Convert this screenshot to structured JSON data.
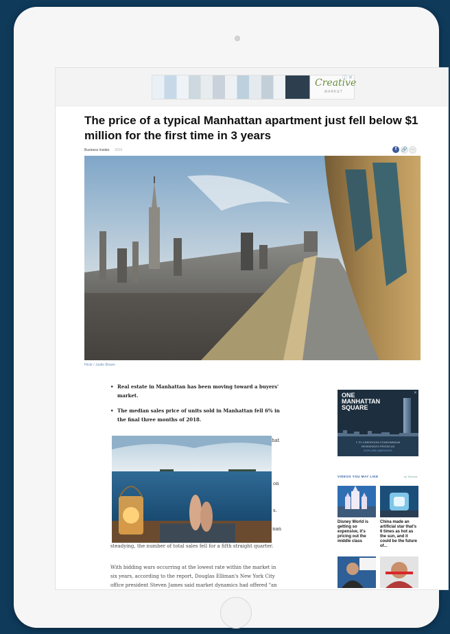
{
  "advert_top": {
    "brand": "Creative",
    "sub": "MARKET",
    "close": "ⓘ ✕"
  },
  "article": {
    "title": "The price of a typical Manhattan apartment just fell below $1 million for the first time in 3 years",
    "author": "Business Insider",
    "date": "2019",
    "photo_credit": "Flickr / Justin Brown",
    "bullets": [
      "Real estate in Manhattan has been moving toward a buyers' market.",
      "The median sales price of units sold in Manhattan fell 6% in the final three months of 2018."
    ],
    "partial_fragments": [
      "hat",
      "on",
      "s.",
      "nan"
    ],
    "paragraphs": [
      "steadying, the number of total sales fell for a fifth straight quarter.",
      "With bidding wars occurring at the lowest rate within the market in six years, according to the report, Douglas Elliman's New York City office president Steven James said market dynamics had offered \"an"
    ]
  },
  "share": {
    "facebook": "f",
    "link": "🔗",
    "more": "⋯"
  },
  "side_ad": {
    "title": "ONE MANHATTAN SQUARE",
    "line1": "1 TO 4 BEDROOM CONDOMINIUM",
    "line2": "RESIDENCES PRICED AS",
    "line3": "EXPLORE AMENITIES",
    "close": "✕"
  },
  "videos": {
    "heading": "VIDEOS YOU MAY LIKE",
    "brand": "by Taboola",
    "items": [
      {
        "caption": "Disney World is getting so expensive, it's pricing out the middle class"
      },
      {
        "caption": "China made an artificial star that's 6 times as hot as the sun, and it could be the future of..."
      }
    ]
  },
  "colors": {
    "background": "#0f3a5a",
    "tablet": "#f6f6f6",
    "facebook": "#3b5998",
    "link_blue": "#2a5aa0"
  }
}
